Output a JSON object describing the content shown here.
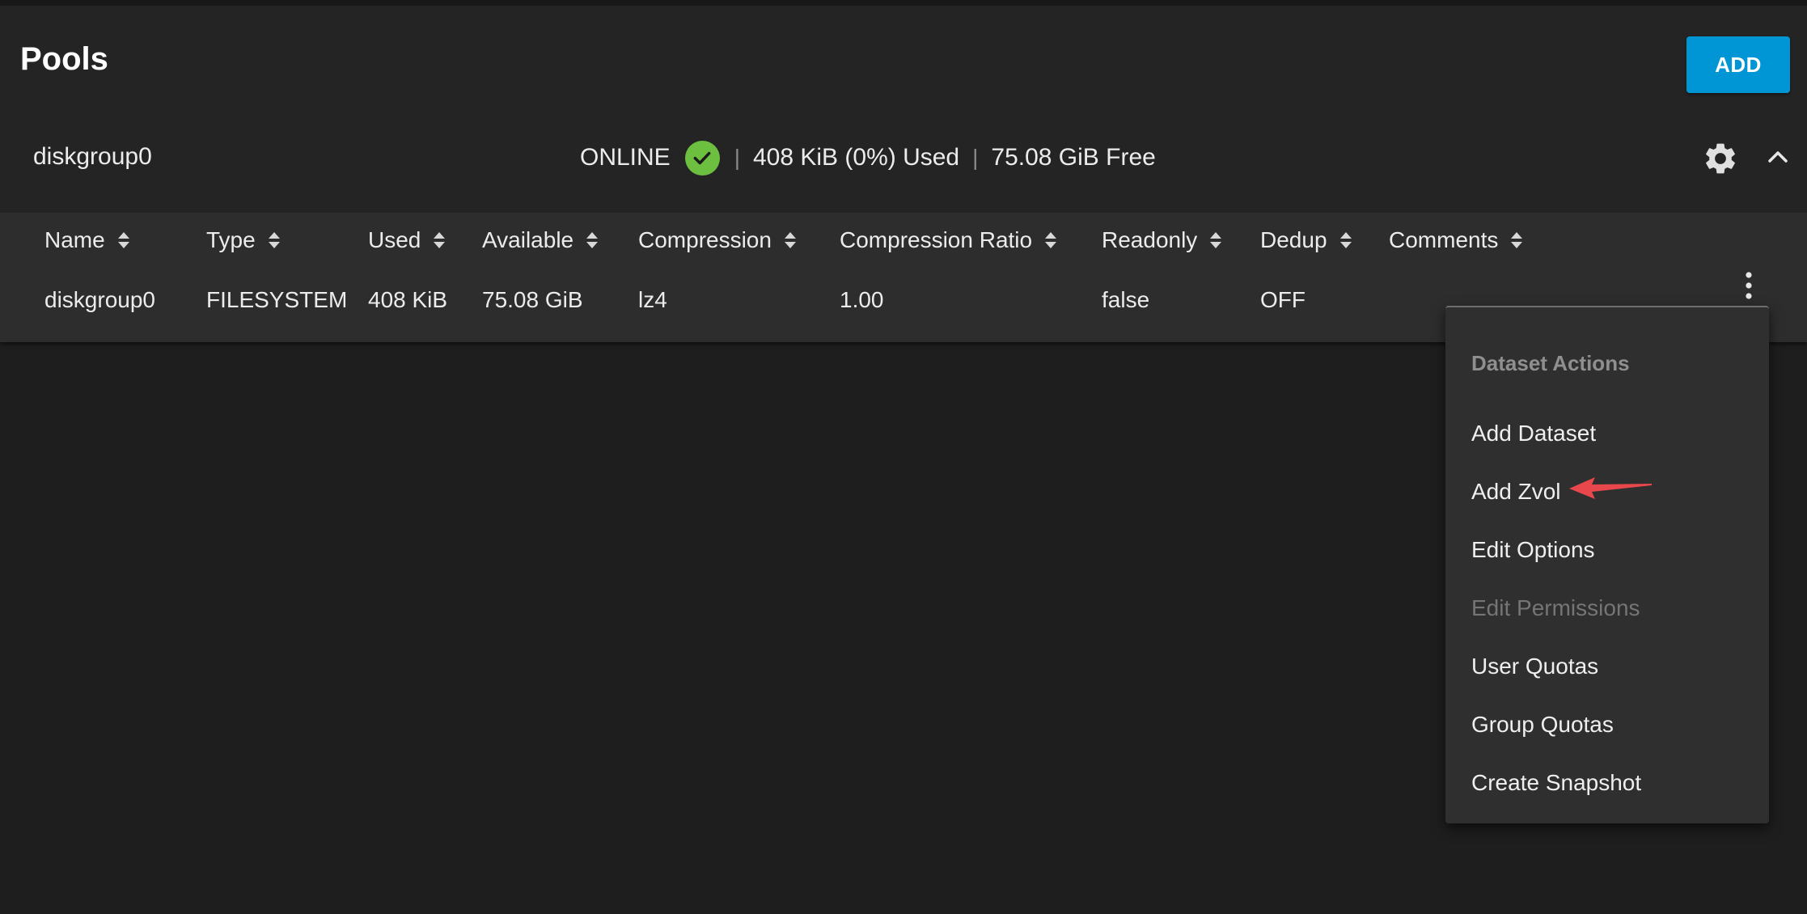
{
  "header": {
    "title": "Pools",
    "add_label": "ADD"
  },
  "pool": {
    "name": "diskgroup0",
    "status": "ONLINE",
    "used": "408 KiB (0%) Used",
    "free": "75.08 GiB Free",
    "separator": "|"
  },
  "table": {
    "columns": [
      "Name",
      "Type",
      "Used",
      "Available",
      "Compression",
      "Compression Ratio",
      "Readonly",
      "Dedup",
      "Comments"
    ],
    "rows": [
      [
        "diskgroup0",
        "FILESYSTEM",
        "408 KiB",
        "75.08 GiB",
        "lz4",
        "1.00",
        "false",
        "OFF",
        ""
      ]
    ]
  },
  "menu": {
    "title": "Dataset Actions",
    "items": [
      {
        "label": "Add Dataset",
        "disabled": false
      },
      {
        "label": "Add Zvol",
        "disabled": false
      },
      {
        "label": "Edit Options",
        "disabled": false
      },
      {
        "label": "Edit Permissions",
        "disabled": true
      },
      {
        "label": "User Quotas",
        "disabled": false
      },
      {
        "label": "Group Quotas",
        "disabled": false
      },
      {
        "label": "Create Snapshot",
        "disabled": false
      }
    ]
  },
  "colors": {
    "accent": "#0095d5",
    "status_ok": "#6cbf3f",
    "annotation_arrow": "#e8474b"
  },
  "icons": [
    "check-circle-icon",
    "gear-icon",
    "chevron-up-icon",
    "sort-icon",
    "more-vert-icon",
    "arrow-annotation-icon"
  ]
}
